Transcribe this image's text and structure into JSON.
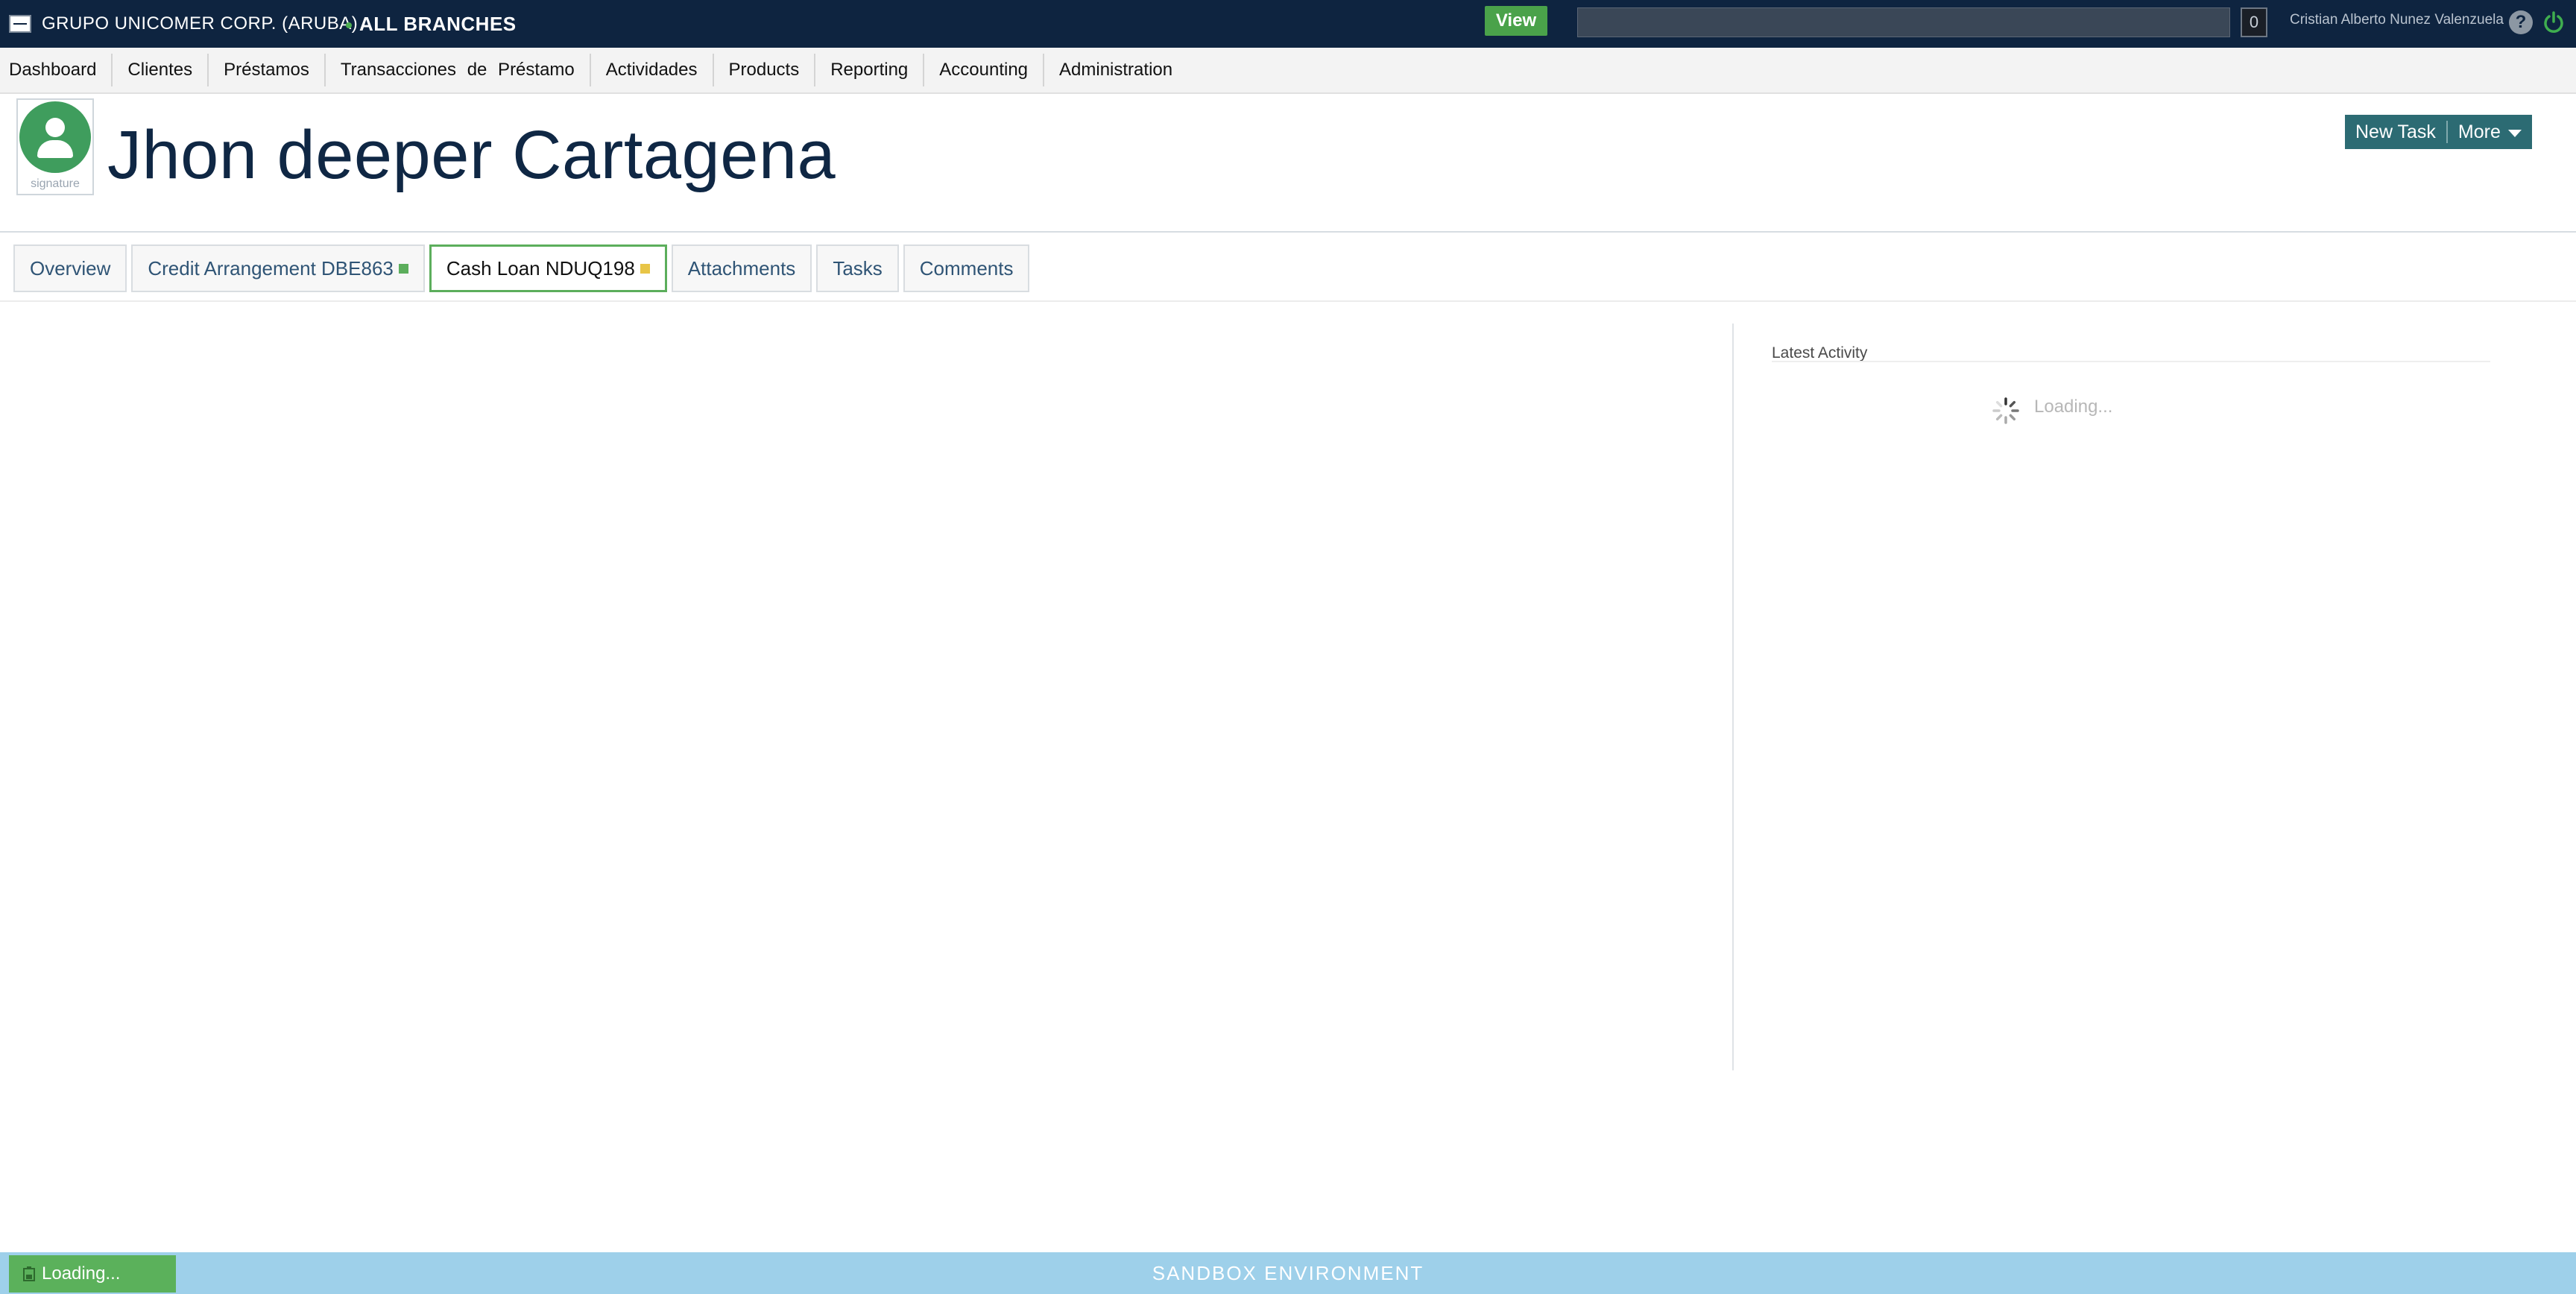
{
  "topbar": {
    "company": "GRUPO UNICOMER CORP. (ARUBA)",
    "branch": "ALL BRANCHES",
    "view_label": "View",
    "search_value": "",
    "notification_count": "0",
    "user_name": "Cristian Alberto Nunez Valenzuela",
    "help_label": "?"
  },
  "nav": {
    "items": [
      "Dashboard",
      "Clientes",
      "Préstamos",
      "Transacciones de Préstamo",
      "Actividades",
      "Products",
      "Reporting",
      "Accounting",
      "Administration"
    ]
  },
  "client": {
    "name": "Jhon deeper Cartagena",
    "avatar_caption": "signature"
  },
  "actions": {
    "new_task": "New Task",
    "more": "More"
  },
  "tabs": [
    {
      "label": "Overview"
    },
    {
      "label": "Credit Arrangement DBE863",
      "status_color": "#5cae5c"
    },
    {
      "label": "Cash Loan NDUQ198",
      "status_color": "#e8c547",
      "active": true
    },
    {
      "label": "Attachments"
    },
    {
      "label": "Tasks"
    },
    {
      "label": "Comments"
    }
  ],
  "activity": {
    "title": "Latest Activity",
    "loading": "Loading..."
  },
  "footer": {
    "loading_label": "Loading...",
    "environment": "SANDBOX ENVIRONMENT"
  }
}
